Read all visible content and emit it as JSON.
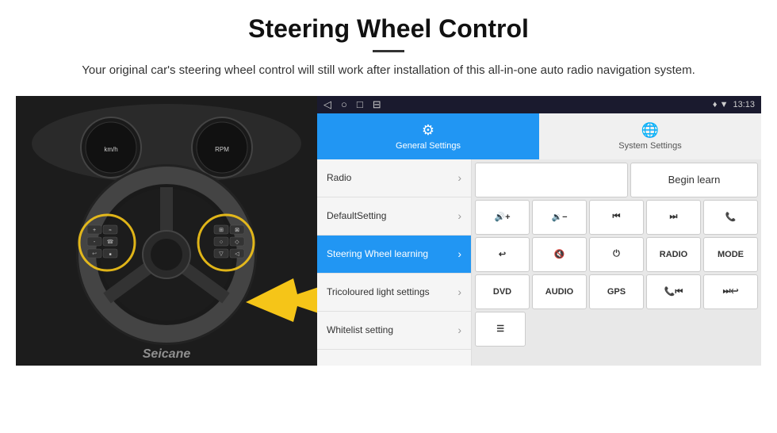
{
  "header": {
    "title": "Steering Wheel Control",
    "subtitle": "Your original car's steering wheel control will still work after installation of this all-in-one auto radio navigation system."
  },
  "android": {
    "status_bar": {
      "nav_icons": [
        "◁",
        "○",
        "□",
        "⊟"
      ],
      "time": "13:13",
      "signal_icons": "♦ ▼"
    },
    "tabs": [
      {
        "label": "General Settings",
        "icon": "⚙",
        "active": true
      },
      {
        "label": "System Settings",
        "icon": "🌐",
        "active": false
      }
    ],
    "menu_items": [
      {
        "label": "Radio",
        "active": false
      },
      {
        "label": "DefaultSetting",
        "active": false
      },
      {
        "label": "Steering Wheel learning",
        "active": true
      },
      {
        "label": "Tricoloured light settings",
        "active": false
      },
      {
        "label": "Whitelist setting",
        "active": false
      }
    ],
    "control_buttons": {
      "row1": [
        "begin_learn"
      ],
      "row2": [
        "vol_up",
        "vol_down",
        "prev",
        "next",
        "phone"
      ],
      "row3": [
        "call_end",
        "mute",
        "power",
        "radio",
        "mode"
      ],
      "row4": [
        "dvd",
        "audio",
        "gps",
        "phone_prev",
        "skip_prev_next"
      ],
      "row5": [
        "menu_icon"
      ]
    }
  },
  "controls": {
    "begin_learn": "Begin learn",
    "vol_up": "🔊+",
    "vol_down": "🔉-",
    "prev": "⏮",
    "next": "⏭",
    "phone": "📞",
    "call_end": "↩",
    "mute": "🔇",
    "power": "⏻",
    "radio_label": "RADIO",
    "mode": "MODE",
    "dvd": "DVD",
    "audio": "AUDIO",
    "gps": "GPS",
    "phone_prev": "📞⏮",
    "skip": "⏭",
    "menu_icon": "☰"
  },
  "watermark": "Seicane"
}
